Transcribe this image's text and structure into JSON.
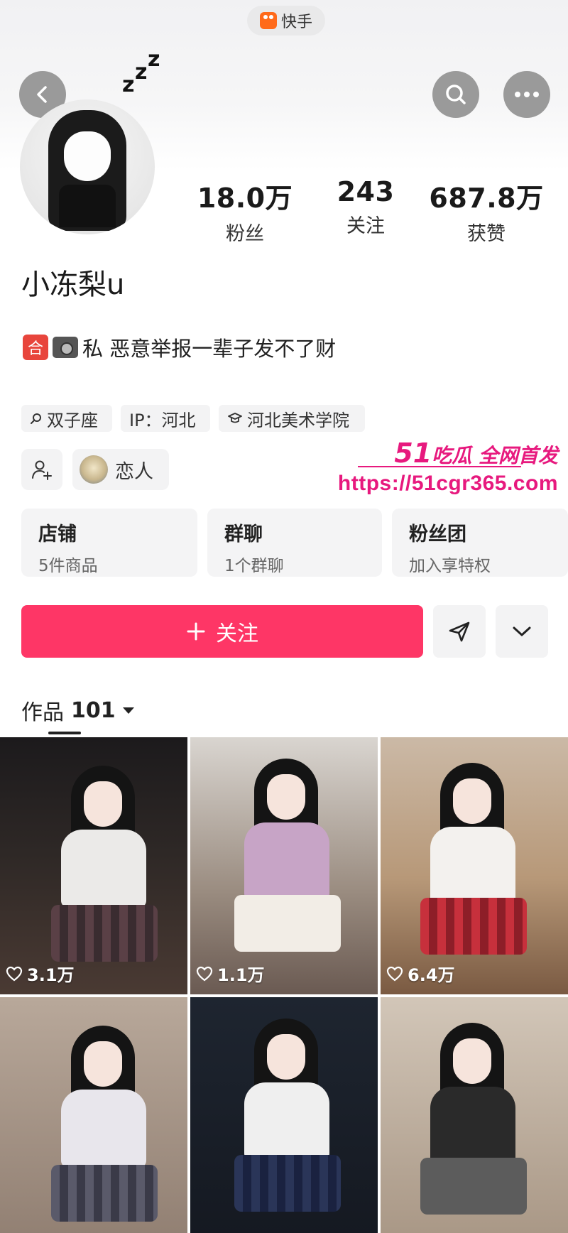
{
  "top_bar": {
    "app_name": "快手"
  },
  "profile": {
    "username": "小冻梨u",
    "stats": [
      {
        "value": "18.0万",
        "label": "粉丝"
      },
      {
        "value": "243",
        "label": "关注"
      },
      {
        "value": "687.8万",
        "label": "获赞"
      }
    ],
    "bio": "私 恶意举报一辈子发不了财",
    "bio_badge": "合",
    "tags": [
      "双子座",
      "IP：河北",
      "河北美术学院"
    ],
    "relation_label": "恋人"
  },
  "watermark": {
    "brand_number": "51",
    "brand_text": "吃瓜 全网首发",
    "url": "https://51cgr365.com"
  },
  "cards": [
    {
      "title": "店铺",
      "subtitle": "5件商品"
    },
    {
      "title": "群聊",
      "subtitle": "1个群聊"
    },
    {
      "title": "粉丝团",
      "subtitle": "加入享特权"
    }
  ],
  "actions": {
    "follow_label": "关注",
    "follow_color": "#fe3666"
  },
  "works": {
    "label": "作品",
    "count": "101",
    "items": [
      {
        "likes": "3.1万"
      },
      {
        "likes": "1.1万"
      },
      {
        "likes": "6.4万"
      }
    ]
  }
}
